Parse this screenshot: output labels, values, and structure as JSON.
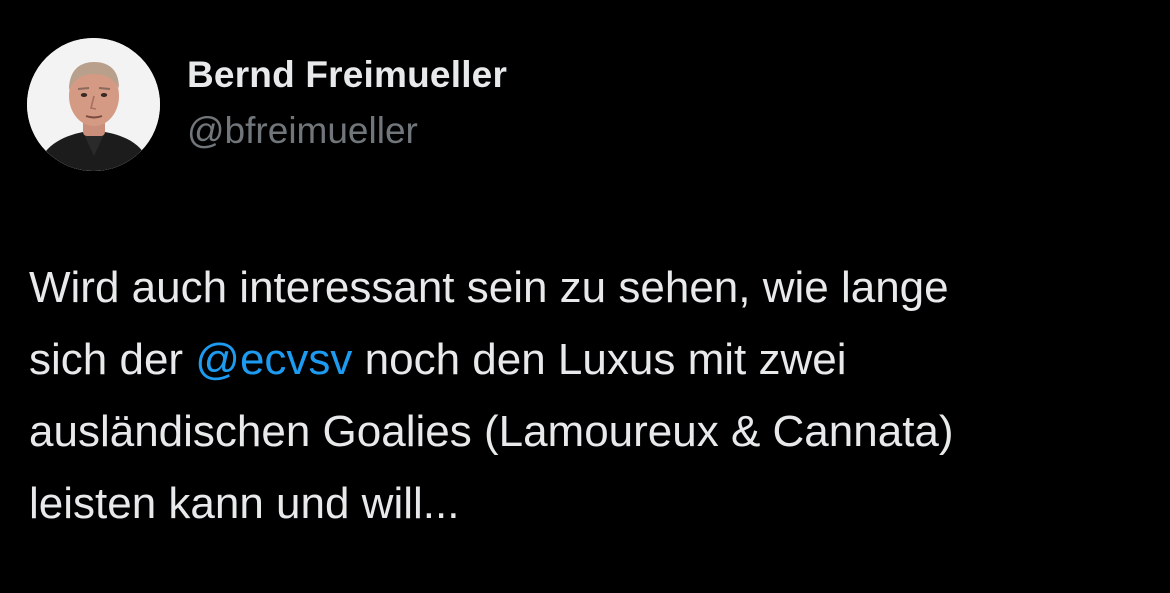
{
  "author": {
    "display_name": "Bernd Freimueller",
    "handle": "@bfreimueller",
    "avatar_icon": "avatar-photo"
  },
  "tweet": {
    "line1": "Wird auch interessant sein zu sehen, wie lange",
    "line2_prefix": "sich der ",
    "mention": "@ecvsv",
    "line2_suffix": " noch den Luxus mit zwei",
    "line3": "ausländischen Goalies (Lamoureux & Cannata)",
    "line4": "leisten kann und will..."
  },
  "colors": {
    "background": "#000000",
    "text": "#e7e9ea",
    "secondary_text": "#71767b",
    "mention": "#1d9bf0"
  }
}
